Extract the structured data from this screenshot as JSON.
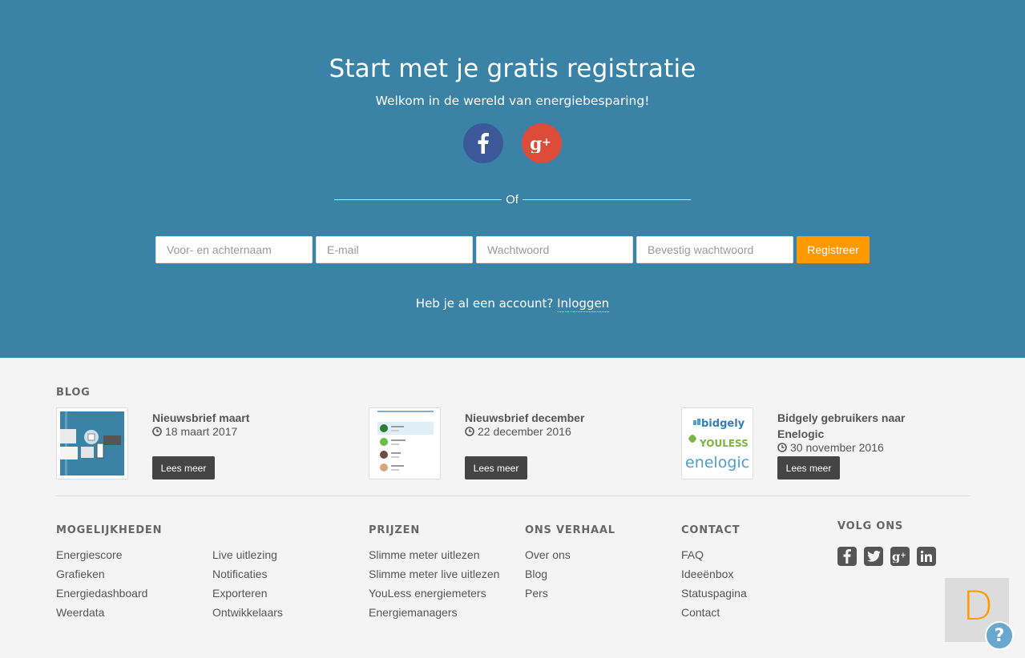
{
  "hero": {
    "title": "Start met je gratis registratie",
    "subtitle": "Welkom in de wereld van energiebesparing!",
    "divider_text": "Of",
    "form": {
      "name_placeholder": "Voor- en achternaam",
      "email_placeholder": "E-mail",
      "password_placeholder": "Wachtwoord",
      "confirm_placeholder": "Bevestig wachtwoord",
      "submit_label": "Registreer"
    },
    "login_prompt": "Heb je al een account?",
    "login_link": "Inloggen",
    "colors": {
      "background": "#3a83a6",
      "accent": "#ff9900",
      "facebook": "#3b5998",
      "google": "#dd4b39"
    }
  },
  "blog": {
    "heading": "BLOG",
    "posts": [
      {
        "title": "Nieuwsbrief maart",
        "date": "18 maart 2017",
        "button": "Lees meer"
      },
      {
        "title": "Nieuwsbrief december",
        "date": "22 december 2016",
        "button": "Lees meer"
      },
      {
        "title": "Bidgely gebruikers naar Enelogic",
        "date": "30 november 2016",
        "button": "Lees meer"
      }
    ],
    "thumb_brands": [
      "bidgely",
      "YOULESS",
      "enelogic"
    ]
  },
  "footer": {
    "mogelijkheden": {
      "heading": "MOGELIJKHEDEN",
      "col1": [
        "Energiescore",
        "Grafieken",
        "Energiedashboard",
        "Weerdata"
      ],
      "col2": [
        "Live uitlezing",
        "Notificaties",
        "Exporteren",
        "Ontwikkelaars"
      ]
    },
    "prijzen": {
      "heading": "PRIJZEN",
      "links": [
        "Slimme meter uitlezen",
        "Slimme meter live uitlezen",
        "YouLess energiemeters",
        "Energiemanagers"
      ]
    },
    "ons_verhaal": {
      "heading": "ONS VERHAAL",
      "links": [
        "Over ons",
        "Blog",
        "Pers"
      ]
    },
    "contact": {
      "heading": "CONTACT",
      "links": [
        "FAQ",
        "Ideeënbox",
        "Statuspagina",
        "Contact"
      ]
    },
    "volg_ons": {
      "heading": "VOLG ONS",
      "icons": [
        "facebook-icon",
        "twitter-icon",
        "google-plus-icon",
        "linkedin-icon"
      ]
    }
  },
  "widget": {
    "letter": "D",
    "help": "?"
  }
}
